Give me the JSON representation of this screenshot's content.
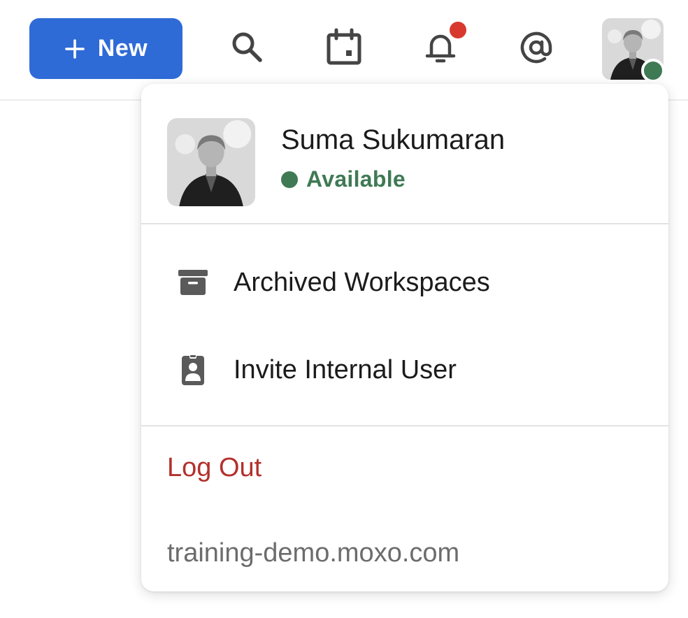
{
  "topbar": {
    "new_button_label": "New",
    "icons": {
      "new": "plus-icon",
      "search": "search-icon",
      "calendar": "calendar-icon",
      "notifications": "bell-icon",
      "mentions": "at-sign-icon"
    },
    "notification_badge_color": "#d8392f",
    "accent_color": "#2f6bd6"
  },
  "user": {
    "name": "Suma Sukumaran",
    "status": "Available",
    "status_color": "#3f7a55"
  },
  "menu": {
    "items": [
      {
        "label": "Archived Workspaces",
        "icon": "archive-box-icon"
      },
      {
        "label": "Invite Internal User",
        "icon": "id-badge-icon"
      }
    ],
    "logout_label": "Log Out",
    "logout_color": "#b3302c",
    "domain": "training-demo.moxo.com"
  }
}
